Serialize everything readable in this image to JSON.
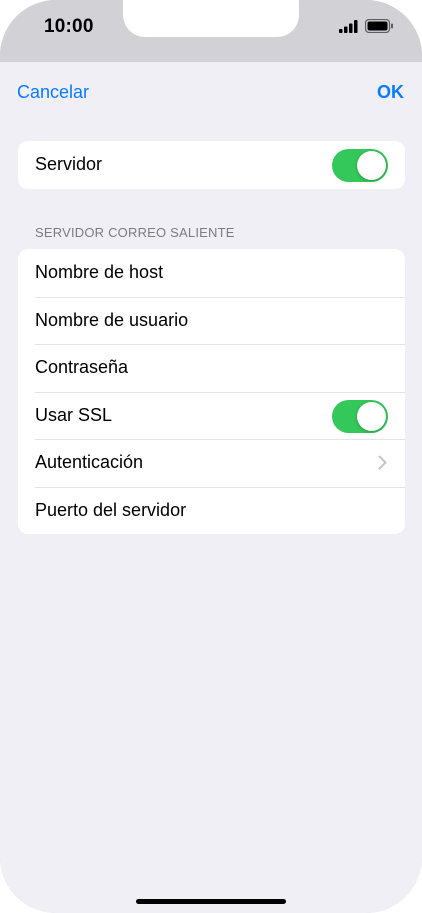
{
  "status_bar": {
    "time": "10:00"
  },
  "nav": {
    "cancel_label": "Cancelar",
    "ok_label": "OK"
  },
  "server_group": {
    "server_label": "Servidor",
    "server_enabled": true
  },
  "outgoing": {
    "section_title": "SERVIDOR CORREO SALIENTE",
    "rows": {
      "hostname": "Nombre de host",
      "username": "Nombre de usuario",
      "password": "Contraseña",
      "use_ssl": "Usar SSL",
      "authentication": "Autenticación",
      "server_port": "Puerto del servidor"
    },
    "use_ssl_enabled": true
  },
  "colors": {
    "accent": "#0a7aff",
    "toggle_on": "#34c759",
    "background": "#f0eff5"
  }
}
